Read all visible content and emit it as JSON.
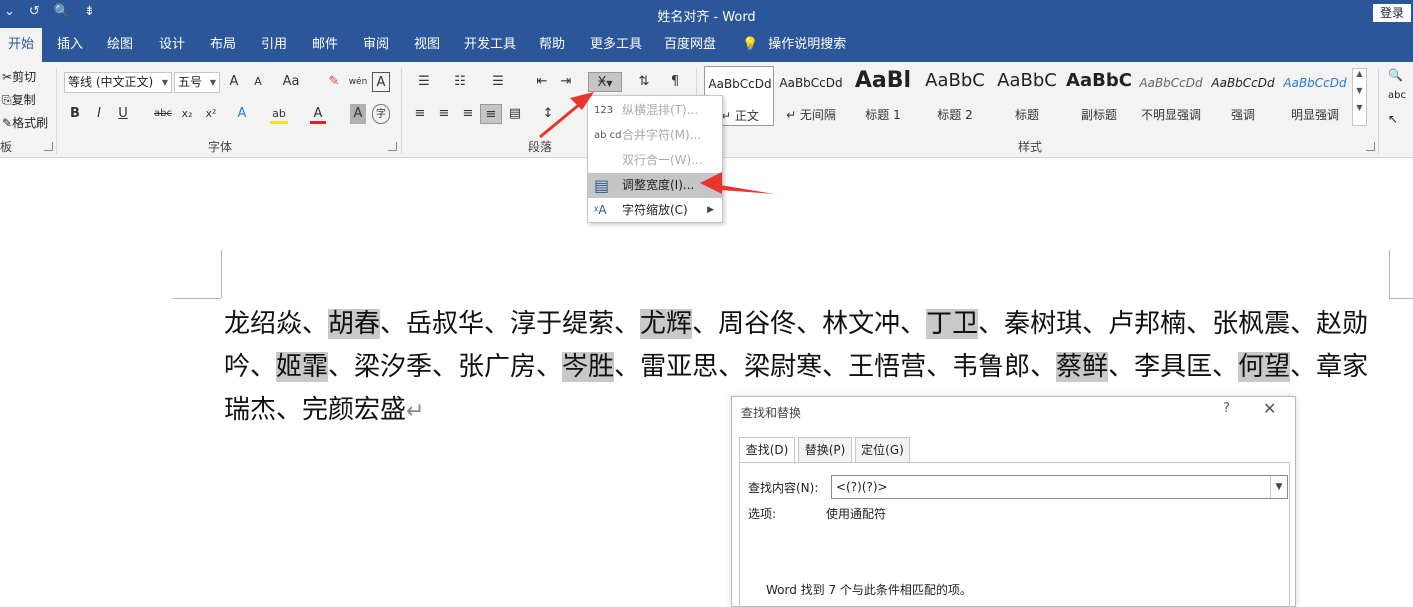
{
  "titlebar": {
    "title": "姓名对齐 - Word",
    "login": "登录",
    "qat": [
      "⌄",
      "↺",
      "🔍",
      "⇟"
    ]
  },
  "tabs": [
    "开始",
    "插入",
    "绘图",
    "设计",
    "布局",
    "引用",
    "邮件",
    "审阅",
    "视图",
    "开发工具",
    "帮助",
    "更多工具",
    "百度网盘"
  ],
  "tell_me": "操作说明搜索",
  "clipboard": {
    "cut": "剪切",
    "copy": "复制",
    "painter": "格式刷",
    "label": "板"
  },
  "font": {
    "name": "等线 (中文正文)",
    "size": "五号",
    "label": "字体",
    "row1": [
      "A",
      "A",
      "Aa",
      "✎",
      "wén",
      "A"
    ],
    "row2": [
      "B",
      "I",
      "U",
      "abc",
      "x₂",
      "x²",
      "A",
      "ab",
      "A",
      "A",
      "字"
    ]
  },
  "paragraph": {
    "label": "段落"
  },
  "styles": {
    "label": "样式",
    "items": [
      {
        "preview": "AaBbCcDd",
        "name": "↵ 正文"
      },
      {
        "preview": "AaBbCcDd",
        "name": "↵ 无间隔"
      },
      {
        "preview": "AaBl",
        "name": "标题 1"
      },
      {
        "preview": "AaBbC",
        "name": "标题 2"
      },
      {
        "preview": "AaBbC",
        "name": "标题"
      },
      {
        "preview": "AaBbC",
        "name": "副标题"
      },
      {
        "preview": "AaBbCcDd",
        "name": "不明显强调"
      },
      {
        "preview": "AaBbCcDd",
        "name": "强调"
      },
      {
        "preview": "AaBbCcDd",
        "name": "明显强调"
      }
    ]
  },
  "menu": {
    "items": [
      {
        "icon": "123",
        "label": "纵横混排(T)...",
        "disabled": true
      },
      {
        "icon": "ab cd",
        "label": "合并字符(M)...",
        "disabled": true
      },
      {
        "icon": "",
        "label": "双行合一(W)...",
        "disabled": true
      },
      {
        "icon": "▤",
        "label": "调整宽度(I)...",
        "disabled": false
      },
      {
        "icon": "ᵡA",
        "label": "字符缩放(C)",
        "disabled": false,
        "submenu": true
      }
    ]
  },
  "document": {
    "segments": [
      {
        "t": "龙绍焱、",
        "hl": false
      },
      {
        "t": "胡春",
        "hl": true
      },
      {
        "t": "、岳叔华、淳于缇萦、",
        "hl": false
      },
      {
        "t": "尤辉",
        "hl": true
      },
      {
        "t": "、周谷佟、林文冲、",
        "hl": false
      },
      {
        "t": "丁卫",
        "hl": true
      },
      {
        "t": "、秦树琪、卢邦楠、张枫震、赵勋吟、",
        "hl": false
      },
      {
        "t": "姬霏",
        "hl": true
      },
      {
        "t": "、梁汐季、张广房、",
        "hl": false
      },
      {
        "t": "岑胜",
        "hl": true
      },
      {
        "t": "、雷亚思、梁尉寒、王悟营、韦鲁郎、",
        "hl": false
      },
      {
        "t": "蔡鲜",
        "hl": true
      },
      {
        "t": "、李具匡、",
        "hl": false
      },
      {
        "t": "何望",
        "hl": true
      },
      {
        "t": "、章家瑞杰、完颜宏盛",
        "hl": false
      }
    ],
    "para_mark": "↵"
  },
  "dialog": {
    "title": "查找和替换",
    "help": "?",
    "close": "✕",
    "tabs": [
      "查找(D)",
      "替换(P)",
      "定位(G)"
    ],
    "find_label": "查找内容(N):",
    "find_value": "<(?)(?)>",
    "options_label": "选项:",
    "options_value": "使用通配符",
    "result": "Word 找到 7 个与此条件相匹配的项。"
  }
}
